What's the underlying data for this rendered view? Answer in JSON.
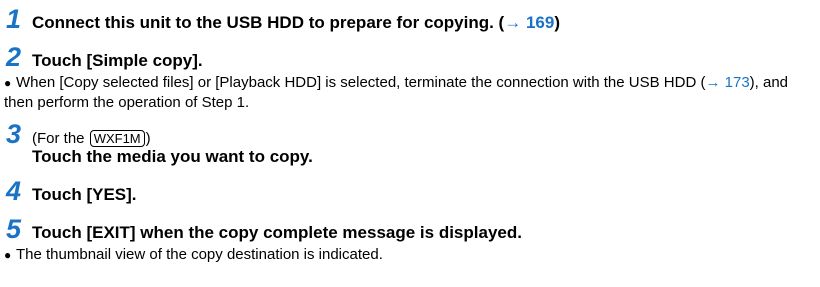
{
  "steps": [
    {
      "number": "1",
      "text": "Connect this unit to the USB HDD to prepare for copying. (",
      "arrow": "→",
      "page_ref": "169",
      "close": ")"
    },
    {
      "number": "2",
      "text": "Touch [Simple copy]."
    },
    {
      "number": "3",
      "sub_prefix": "(For the ",
      "model": "WXF1M",
      "sub_suffix": ")",
      "text": "Touch the media you want to copy."
    },
    {
      "number": "4",
      "text": "Touch [YES]."
    },
    {
      "number": "5",
      "text": "Touch [EXIT] when the copy complete message is displayed."
    }
  ],
  "notes": {
    "step2_note": {
      "bullet": "●",
      "text_a": "When [Copy selected files] or [Playback HDD] is selected, terminate the connection with the USB HDD (",
      "arrow": "→",
      "page_ref": "173",
      "text_b": "), and then perform the operation of Step 1."
    },
    "step5_note": {
      "bullet": "●",
      "text": "The thumbnail view of the copy destination is indicated."
    }
  },
  "colors": {
    "accent": "#1a73c4",
    "text": "#000000"
  }
}
